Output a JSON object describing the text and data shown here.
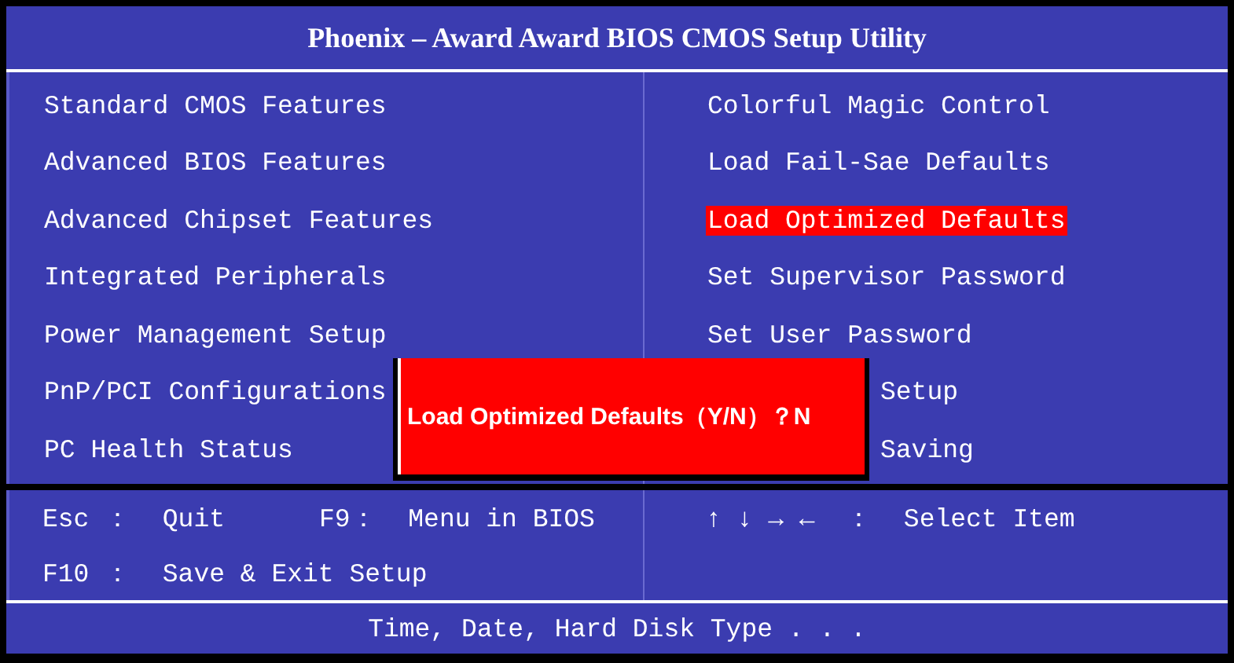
{
  "window": {
    "title": "Phoenix – Award Award BIOS CMOS Setup Utility"
  },
  "menu": {
    "left": [
      {
        "label": "Standard CMOS Features",
        "selected": false
      },
      {
        "label": "Advanced BIOS Features",
        "selected": false
      },
      {
        "label": "Advanced Chipset Features",
        "selected": false
      },
      {
        "label": "Integrated Peripherals",
        "selected": false
      },
      {
        "label": "Power Management Setup",
        "selected": false
      },
      {
        "label": "PnP/PCI Configurations",
        "selected": false
      },
      {
        "label": "PC Health Status",
        "selected": false
      }
    ],
    "right": [
      {
        "label": "Colorful Magic Control",
        "selected": false
      },
      {
        "label": "Load Fail-Sae Defaults",
        "selected": false
      },
      {
        "label": "Load Optimized Defaults",
        "selected": true
      },
      {
        "label": "Set Supervisor Password",
        "selected": false
      },
      {
        "label": "Set User Password",
        "selected": false
      },
      {
        "label": "Setup",
        "selected": false,
        "covered": true
      },
      {
        "label": "Saving",
        "selected": false,
        "covered": true
      }
    ]
  },
  "dialog": {
    "text": "Load Optimized Defaults（Y/N）？N"
  },
  "help": {
    "left": [
      [
        "Esc ：  Quit",
        "F9：  Menu in BIOS"
      ],
      [
        "F10 ：  Save & Exit Setup"
      ]
    ],
    "right": [
      "↑ ↓ → ←  ：  Select Item"
    ]
  },
  "status_bar": "Time, Date, Hard Disk Type . . ."
}
